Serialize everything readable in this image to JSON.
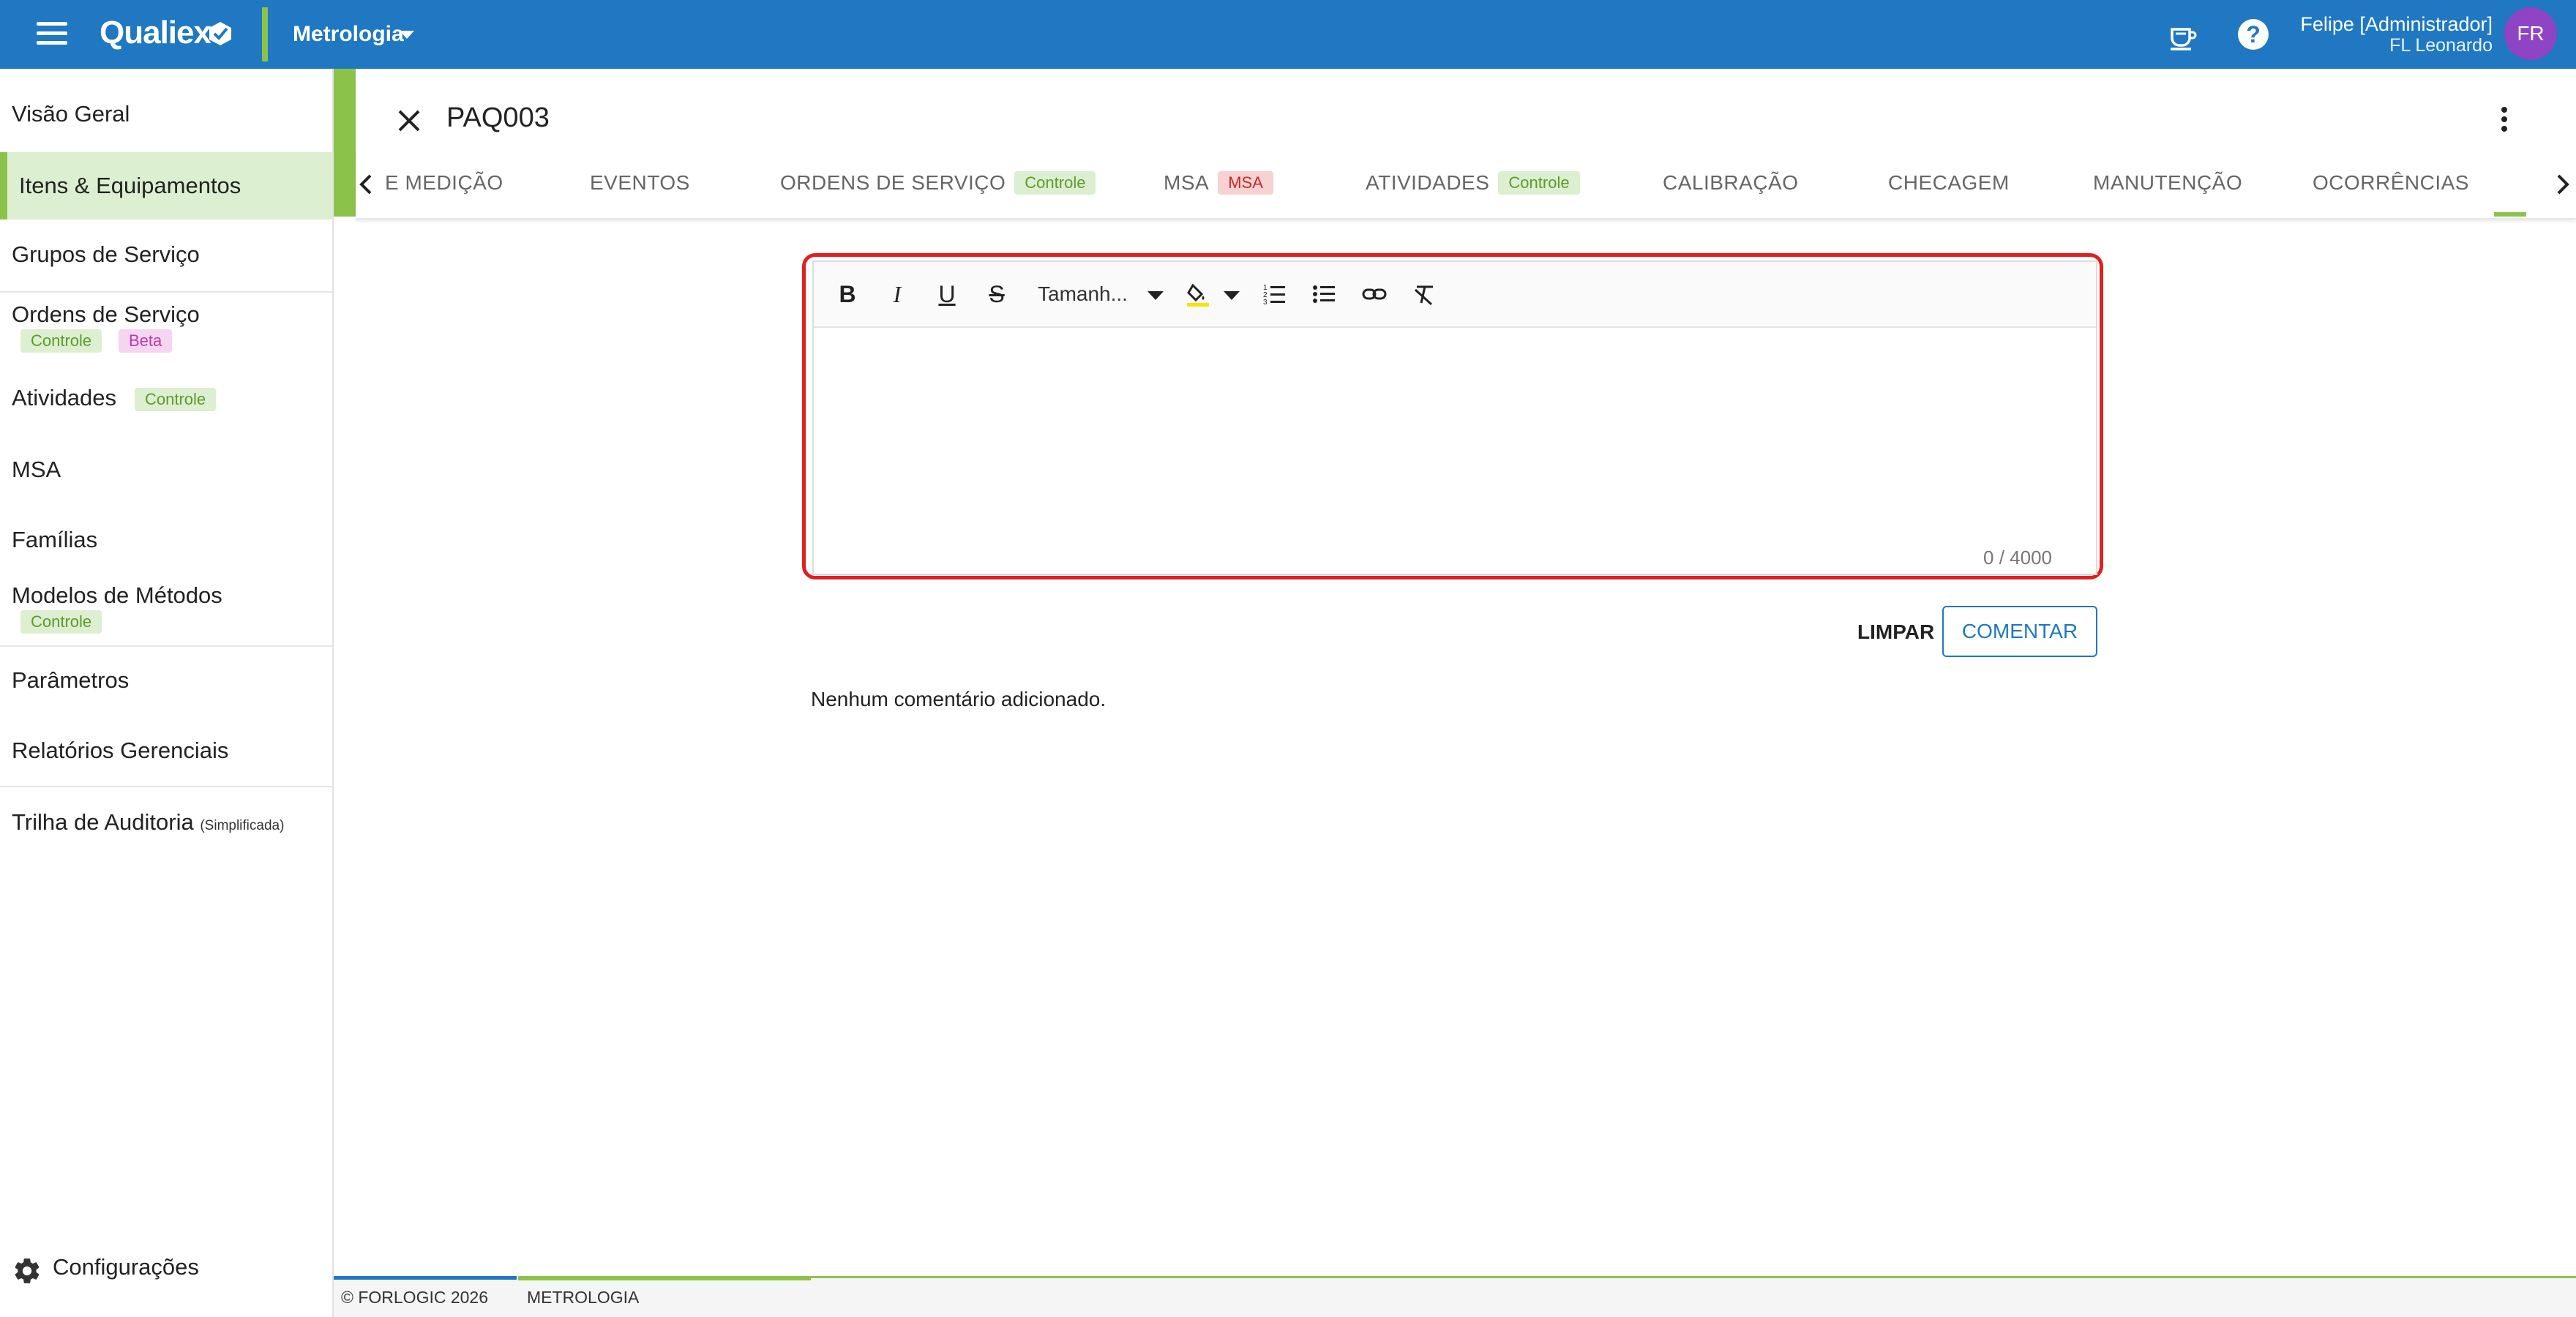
{
  "topbar": {
    "brand": "Qualiex",
    "module": "Metrologia",
    "user_name": "Felipe [Administrador]",
    "user_company": "FL Leonardo",
    "avatar_initials": "FR",
    "help_glyph": "?",
    "colors": {
      "bar": "#1f78c1",
      "accent": "#8bc34a",
      "avatar": "#8e44c4"
    }
  },
  "sidebar": {
    "items": [
      {
        "label": "Visão Geral"
      },
      {
        "label": "Itens & Equipamentos",
        "active": true
      },
      {
        "label": "Grupos de Serviço"
      },
      {
        "label": "Ordens de Serviço",
        "chips": [
          "Controle",
          "Beta"
        ]
      },
      {
        "label": "Atividades",
        "chips": [
          "Controle"
        ]
      },
      {
        "label": "MSA"
      },
      {
        "label": "Famílias"
      },
      {
        "label": "Modelos de Métodos",
        "chips": [
          "Controle"
        ]
      },
      {
        "label": "Parâmetros"
      },
      {
        "label": "Relatórios Gerenciais"
      },
      {
        "label": "Trilha de Auditoria",
        "suffix": "(Simplificada)"
      }
    ],
    "settings_label": "Configurações"
  },
  "page": {
    "title": "PAQ003"
  },
  "tabs": [
    {
      "label": "E MEDIÇÃO"
    },
    {
      "label": "EVENTOS"
    },
    {
      "label": "ORDENS DE SERVIÇO",
      "chip": "Controle"
    },
    {
      "label": "MSA",
      "chip": "MSA"
    },
    {
      "label": "ATIVIDADES",
      "chip": "Controle"
    },
    {
      "label": "CALIBRAÇÃO"
    },
    {
      "label": "CHECAGEM"
    },
    {
      "label": "MANUTENÇÃO"
    },
    {
      "label": "OCORRÊNCIAS"
    }
  ],
  "editor": {
    "font_size_label": "Tamanh...",
    "char_count": "0 / 4000",
    "toolbar_icons": [
      "bold-icon",
      "italic-icon",
      "underline-icon",
      "strikethrough-icon",
      "highlight-color-icon",
      "ordered-list-icon",
      "bullet-list-icon",
      "link-icon",
      "clear-format-icon"
    ]
  },
  "actions": {
    "clear_label": "LIMPAR",
    "comment_label": "COMENTAR"
  },
  "comments": {
    "empty_message": "Nenhum comentário adicionado."
  },
  "footer": {
    "copyright": "© FORLOGIC 2026",
    "module": "METROLOGIA"
  }
}
